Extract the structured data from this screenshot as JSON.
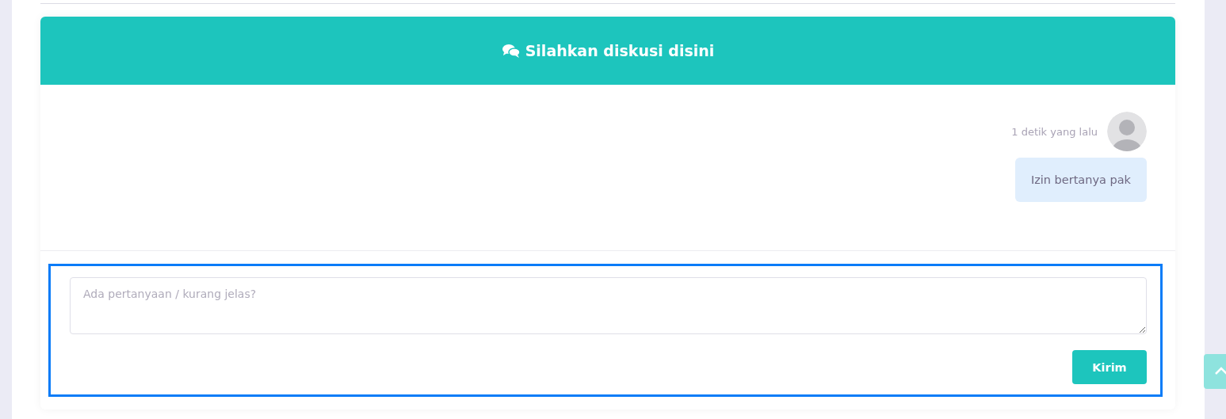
{
  "header": {
    "title": "Silahkan diskusi disini"
  },
  "messages": [
    {
      "time": "1 detik yang lalu",
      "text": "Izin bertanya pak"
    }
  ],
  "form": {
    "placeholder": "Ada pertanyaan / kurang jelas?",
    "submit": "Kirim"
  }
}
